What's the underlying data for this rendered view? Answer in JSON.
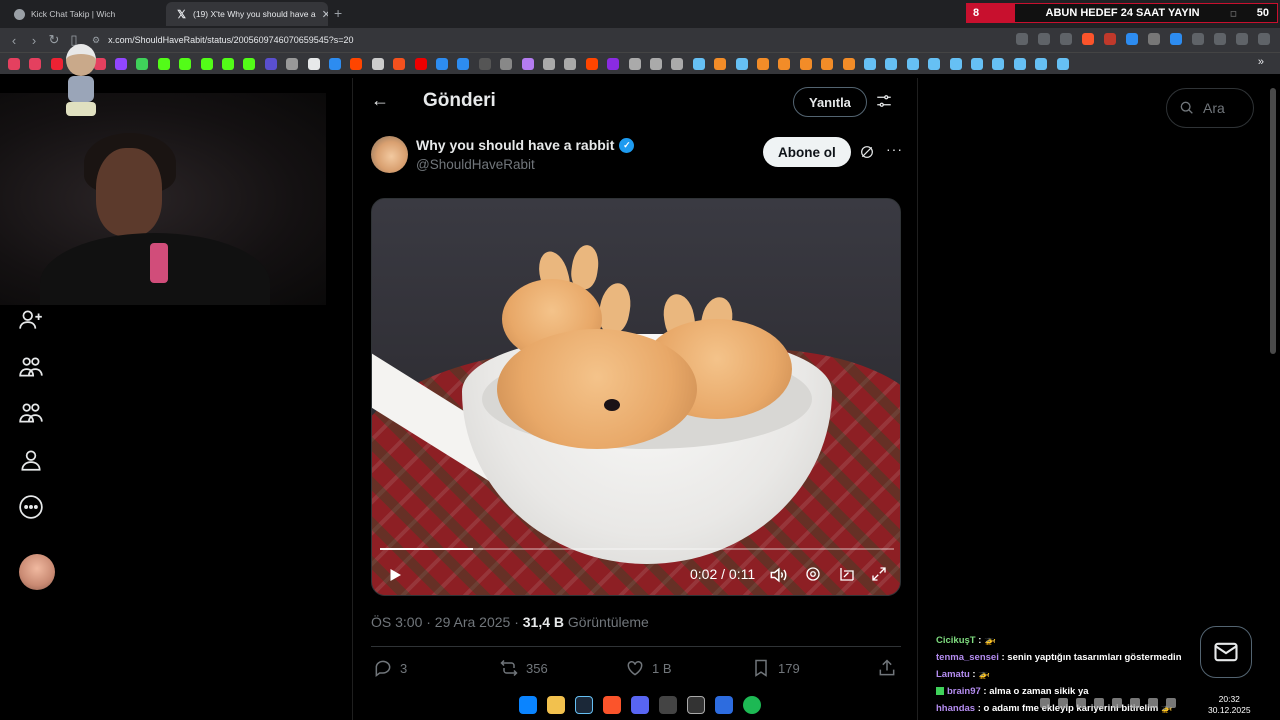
{
  "browser": {
    "tabs": [
      {
        "title": "Kick Chat Takip | Wich",
        "active": false
      },
      {
        "title": "(19) X'te Why you should have a",
        "active": true
      }
    ],
    "url": "x.com/ShouldHaveRabit/status/2005609746070659545?s=20"
  },
  "overlay": {
    "left_number": "8",
    "title": "ABUN HEDEF 24 SAAT YAYIN",
    "right_number": "50"
  },
  "header": {
    "title": "Gönderi",
    "reply_label": "Yanıtla"
  },
  "post": {
    "author_name": "Why you should have a rabbit",
    "author_handle": "@ShouldHaveRabit",
    "follow_label": "Abone ol",
    "video": {
      "time": "0:02 / 0:11",
      "progress": 0.18
    },
    "timestamp": "ÖS 3:00 · 29 Ara 2025 · ",
    "views_count": "31,4 B",
    "views_label": " Görüntüleme",
    "stats": {
      "replies": "3",
      "reposts": "356",
      "likes": "1 B",
      "bookmarks": "179"
    }
  },
  "search": {
    "placeholder": "Ara"
  },
  "chat": [
    {
      "user": "CicikuşT",
      "text": " : 🚁"
    },
    {
      "user": "tenma_sensei",
      "text": " : senin yaptığın tasarımları göstermedin"
    },
    {
      "user": "Lamatu",
      "text": " : 🚁"
    },
    {
      "user": "brain97",
      "text": " : alma o zaman sikik ya"
    },
    {
      "user": "hhandas",
      "text": " : o adamı fme ekleyip kariyerini bitirelim 🚁"
    }
  ],
  "clock": {
    "time": "20:32",
    "date": "30.12.2025"
  },
  "colors": {
    "accent": "#1d9bf0",
    "overlay_red": "#c8102e",
    "background": "#000000"
  }
}
